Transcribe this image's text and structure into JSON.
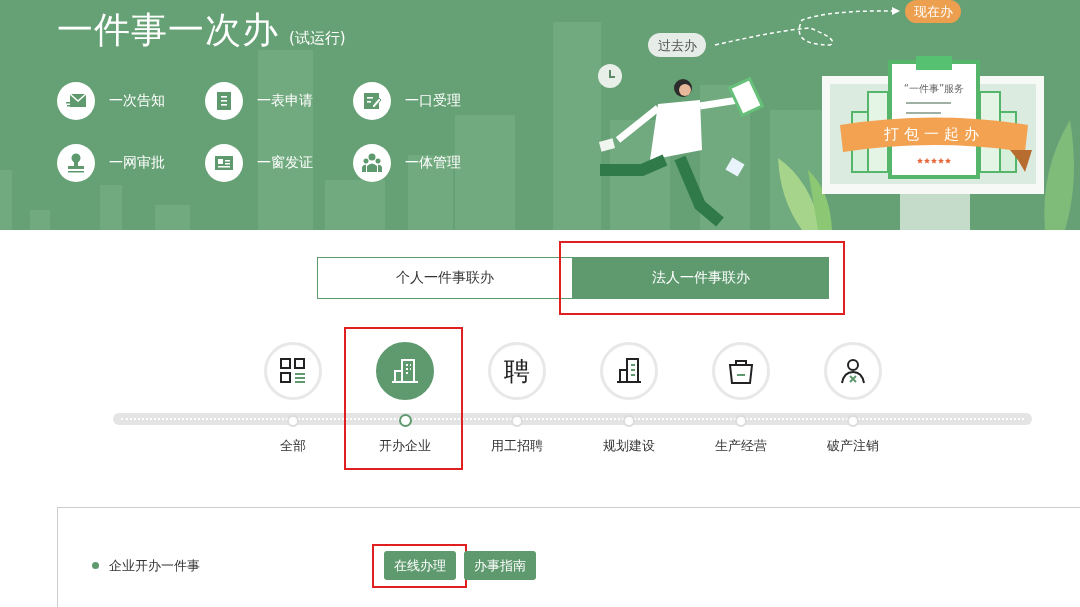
{
  "banner": {
    "title": "一件事一次办",
    "subtitle": "(试运行)",
    "features": [
      {
        "label": "一次告知",
        "kind": "mail"
      },
      {
        "label": "一表申请",
        "kind": "list"
      },
      {
        "label": "一口受理",
        "kind": "edit"
      },
      {
        "label": "一网审批",
        "kind": "stamp"
      },
      {
        "label": "一窗发证",
        "kind": "card"
      },
      {
        "label": "一体管理",
        "kind": "people"
      }
    ],
    "illustration": {
      "past_label": "过去办",
      "now_label": "现在办",
      "card_title": "“一件事”服务",
      "ribbon_text": "打包一起办",
      "stars": 5
    }
  },
  "tabs": [
    {
      "label": "个人一件事联办",
      "selected": false,
      "highlighted": false
    },
    {
      "label": "法人一件事联办",
      "selected": true,
      "highlighted": true
    }
  ],
  "categories": [
    {
      "label": "全部",
      "kind": "grid",
      "selected": false,
      "highlighted": false
    },
    {
      "label": "开办企业",
      "kind": "building",
      "selected": true,
      "highlighted": true
    },
    {
      "label": "用工招聘",
      "kind": "char",
      "icon_char": "聘",
      "selected": false,
      "highlighted": false
    },
    {
      "label": "规划建设",
      "kind": "buildings",
      "selected": false,
      "highlighted": false
    },
    {
      "label": "生产经营",
      "kind": "bag",
      "selected": false,
      "highlighted": false
    },
    {
      "label": "破产注销",
      "kind": "person",
      "selected": false,
      "highlighted": false
    }
  ],
  "items": [
    {
      "label": "企业开办一件事",
      "buttons": [
        {
          "label": "在线办理",
          "highlighted": true
        },
        {
          "label": "办事指南",
          "highlighted": false
        }
      ]
    }
  ]
}
